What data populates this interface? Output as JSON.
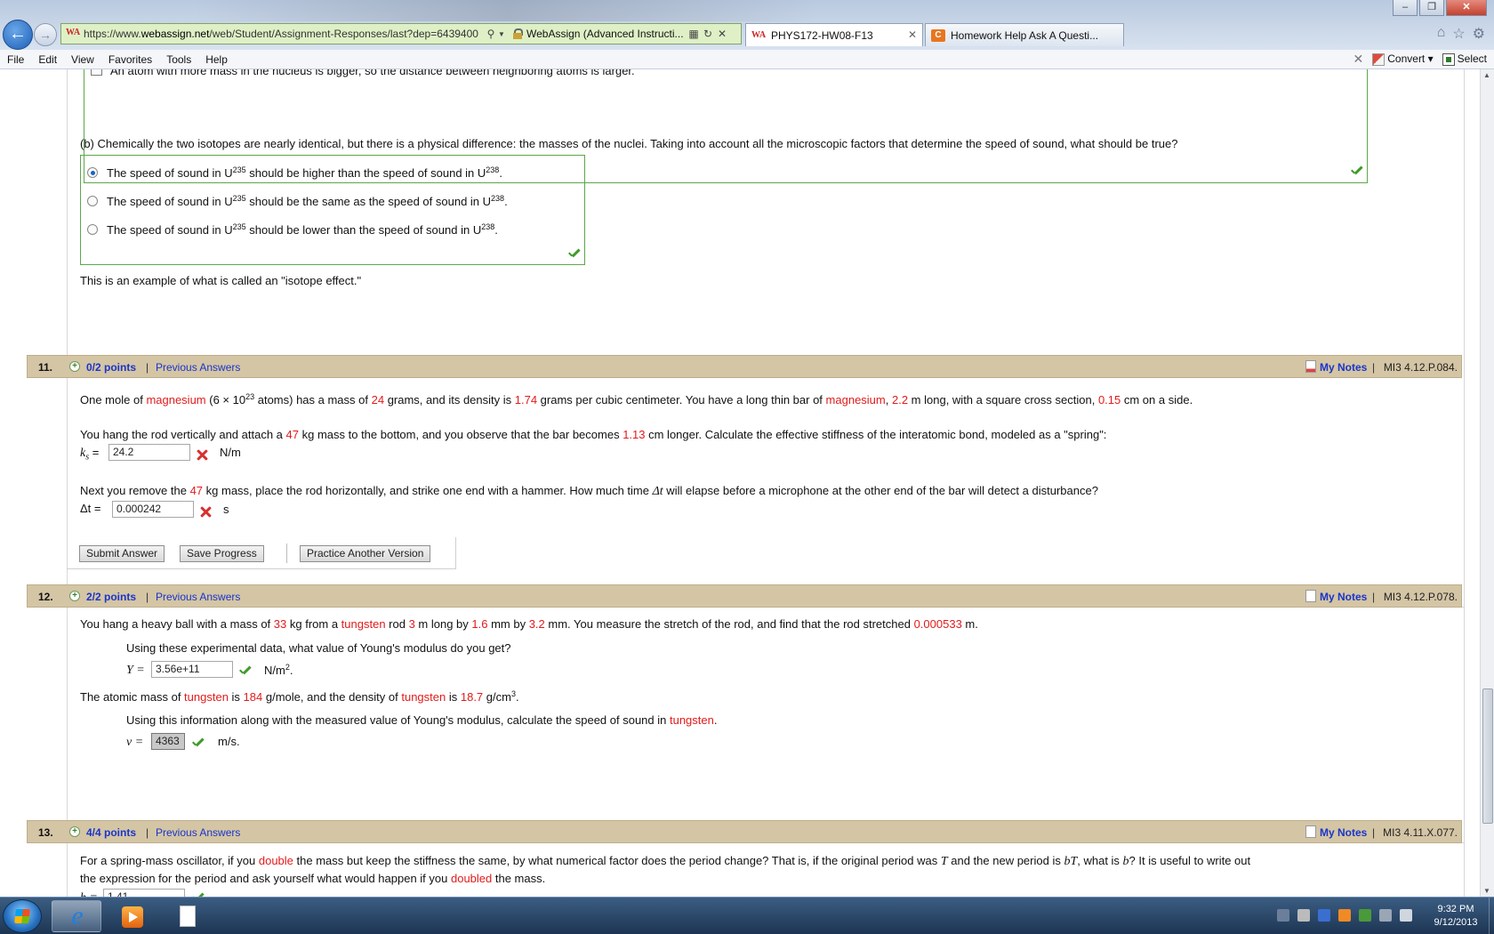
{
  "browser": {
    "url_prefix": "https://www.",
    "url_host": "webassign.net",
    "url_path": "/web/Student/Assignment-Responses/last?dep=6439400",
    "site_label": "WebAssign (Advanced Instructi...",
    "tabs": [
      {
        "label": "PHYS172-HW08-F13",
        "icon": "webassign-icon",
        "active": true
      },
      {
        "label": "Homework Help Ask A Questi...",
        "icon": "chegg-icon",
        "active": false
      }
    ],
    "menu": [
      "File",
      "Edit",
      "View",
      "Favorites",
      "Tools",
      "Help"
    ],
    "convert_label": "Convert",
    "select_label": "Select"
  },
  "q10": {
    "checkbox_option": "An atom with more mass in the nucleus is bigger, so the distance between neighboring atoms is larger.",
    "part_b_prompt": "(b) Chemically the two isotopes are nearly identical, but there is a physical difference: the masses of the nuclei. Taking into account all the microscopic factors that determine the speed of sound, what should be true?",
    "options": [
      {
        "pre": "The speed of sound in U",
        "sup1": "235",
        "mid": " should be higher than the speed of sound in U",
        "sup2": "238",
        "post": ".",
        "selected": true
      },
      {
        "pre": "The speed of sound in U",
        "sup1": "235",
        "mid": " should be the same as the speed of sound in U",
        "sup2": "238",
        "post": ".",
        "selected": false
      },
      {
        "pre": "The speed of sound in U",
        "sup1": "235",
        "mid": " should be lower than the speed of sound in U",
        "sup2": "238",
        "post": ".",
        "selected": false
      }
    ],
    "footnote": "This is an example of what is called an \"isotope effect.\""
  },
  "q11": {
    "number": "11.",
    "points": "0/2 points",
    "previous": "Previous Answers",
    "notes": "My Notes",
    "code": "MI3 4.12.P.084.",
    "text1": {
      "a": "One mole of ",
      "metal": "magnesium",
      "b": " (6 × 10",
      "exp": "23",
      "c": " atoms) has a mass of ",
      "mass": "24",
      "d": " grams, and its density is ",
      "density": "1.74",
      "e": " grams per cubic centimeter. You have a long thin bar of ",
      "metal2": "magnesium",
      "f": ", ",
      "length": "2.2",
      "g": " m long, with a square cross section, ",
      "side": "0.15",
      "h": " cm on a side."
    },
    "text2": {
      "a": "You hang the rod vertically and attach a ",
      "mass": "47",
      "b": " kg mass to the bottom, and you observe that the bar becomes ",
      "stretch": "1.13",
      "c": " cm longer. Calculate the effective stiffness of the interatomic bond, modeled as a \"spring\":"
    },
    "ks_label": "k",
    "ks_sub": "s",
    "ks_eq": " =",
    "ks_value": "24.2",
    "ks_unit": "N/m",
    "text3": {
      "a": "Next you remove the ",
      "mass": "47",
      "b": " kg mass, place the rod horizontally, and strike one end with a hammer. How much time ",
      "delta": "Δt",
      "c": " will elapse before a microphone at the other end of the bar will detect a disturbance?"
    },
    "dt_label": "Δt =",
    "dt_value": "0.000242",
    "dt_unit": "s",
    "submit_label": "Submit Answer",
    "save_label": "Save Progress",
    "practice_label": "Practice Another Version"
  },
  "q12": {
    "number": "12.",
    "points": "2/2 points",
    "previous": "Previous Answers",
    "notes": "My Notes",
    "code": "MI3 4.12.P.078.",
    "text1": {
      "a": "You hang a heavy ball with a mass of ",
      "mass": "33",
      "b": " kg from a ",
      "metal": "tungsten",
      "c": " rod ",
      "len": "3",
      "d": " m long by ",
      "w": "1.6",
      "e": " mm by ",
      "h": "3.2",
      "f": " mm. You measure the stretch of the rod, and find that the rod stretched ",
      "stretch": "0.000533",
      "g": " m."
    },
    "prompt_y": "Using these experimental data, what value of Young's modulus do you get?",
    "y_label": "Y =",
    "y_value": "3.56e+11",
    "y_unit": "N/m",
    "y_unit_sup": "2",
    "y_unit_post": ".",
    "text2": {
      "a": "The atomic mass of ",
      "metal": "tungsten",
      "b": " is ",
      "am": "184",
      "c": " g/mole, and the density of ",
      "metal2": "tungsten",
      "d": " is ",
      "density": "18.7",
      "e": " g/cm",
      "sup": "3",
      "f": "."
    },
    "prompt_v": {
      "a": "Using this information along with the measured value of Young's modulus, calculate the speed of sound in ",
      "metal": "tungsten",
      "b": "."
    },
    "v_label": "v =",
    "v_value": "4363",
    "v_unit": "m/s."
  },
  "q13": {
    "number": "13.",
    "points": "4/4 points",
    "previous": "Previous Answers",
    "notes": "My Notes",
    "code": "MI3 4.11.X.077.",
    "line1": {
      "a": "For a spring-mass oscillator, if you ",
      "w": "double",
      "b": " the mass but keep the stiffness the same, by what numerical factor does the period change? That is, if the original period was ",
      "T": "T",
      "c": " and the new period is ",
      "bT": "bT",
      "d": ", what is ",
      "b2": "b",
      "e": "? It is useful to write out"
    },
    "line2": {
      "a": "the expression for the period and ask yourself what would happen if you ",
      "w": "doubled",
      "b": " the mass."
    },
    "b_label": "b =",
    "b_value": "1.41"
  },
  "taskbar": {
    "time": "9:32 PM",
    "date": "9/12/2013"
  },
  "colors": {
    "header_bg": "#d4c5a5",
    "link_blue": "#1a35c9",
    "value_red": "#e21b1b",
    "correct_green": "#3f9a2a"
  }
}
